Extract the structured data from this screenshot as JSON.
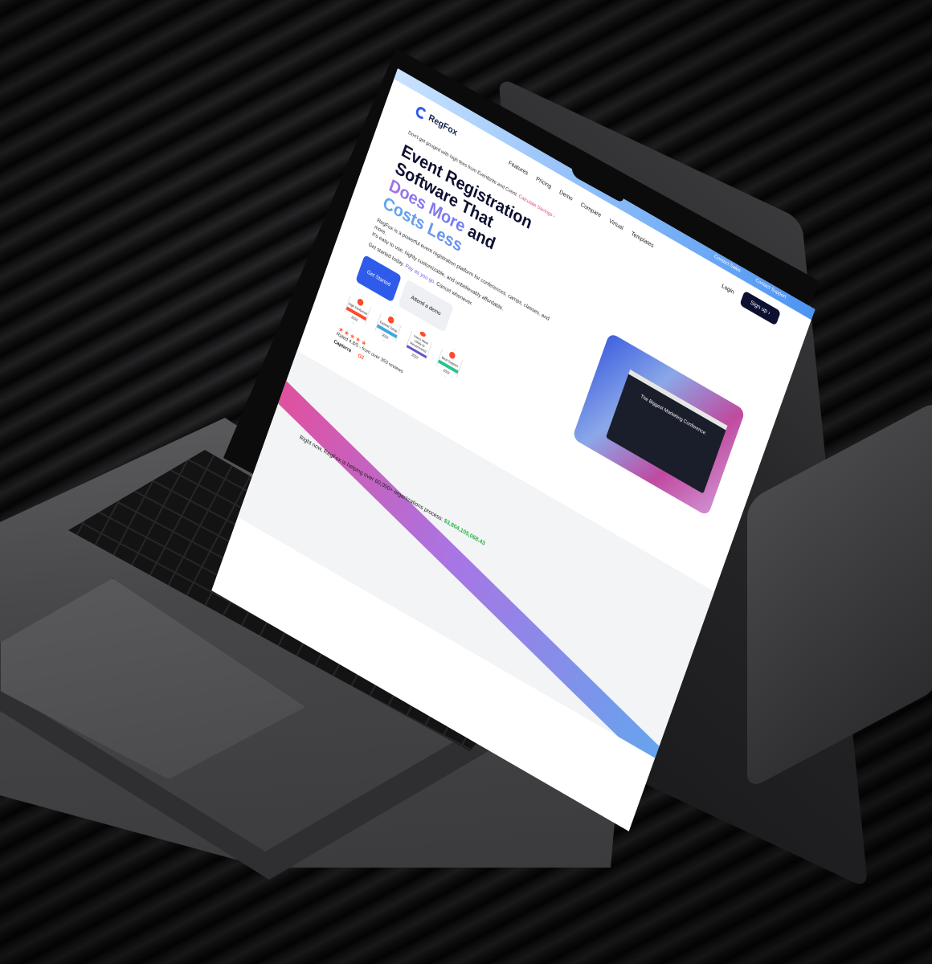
{
  "site": {
    "brand": "RegFox",
    "topbar": {
      "contact_sales": "Contact Sales",
      "contact_support": "Contact Support"
    },
    "nav": {
      "links": [
        "Features",
        "Pricing",
        "Demo",
        "Compare",
        "Virtual",
        "Templates"
      ],
      "login": "Login",
      "signup": "Sign up"
    },
    "promo": {
      "text": "Don't get gouged with high fees from Eventbrite and Cvent.",
      "savings": "Calculate Savings"
    },
    "hero": {
      "line1": "Event Registration Software That",
      "line2_grad": "Does More",
      "line2_rest": "and",
      "line3_grad": "Costs Less",
      "desc1": "RegFox is a powerful event registration platform for conferences, camps, classes, and more.",
      "desc2": "It's easy to use, highly customizable, and unbelievably affordable.",
      "sub_start": "Get started today.",
      "sub_link": "Pay as you go.",
      "sub_end": "Cancel whenever.",
      "cta_primary": "Get Started",
      "cta_secondary": "Attend a demo"
    },
    "badges": [
      {
        "top": "High Performer",
        "year": "2022",
        "color": "#ff492c"
      },
      {
        "top": "Easiest Setup",
        "year": "2022",
        "color": "#3fa7e0"
      },
      {
        "top": "Users Most Likely to Recommend",
        "year": "2022",
        "color": "#6b4ec9"
      },
      {
        "top": "Best Support",
        "year": "2022",
        "color": "#27c48f"
      }
    ],
    "rating": {
      "stars": "★★★★★",
      "text": "Rated 4.8/5 - from over 350 reviews",
      "logo1": "Capterra",
      "logo2": "G2"
    },
    "mock": {
      "title": "The Biggest Marketing Conference"
    },
    "processing": {
      "text": "Right now, RegFox is helping over 60,000+ organizations process:",
      "amount": "$3,804,105,068.43"
    }
  }
}
